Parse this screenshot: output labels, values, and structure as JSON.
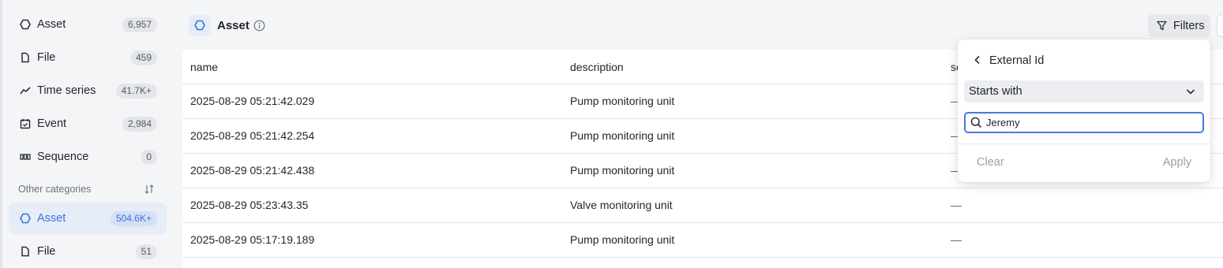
{
  "sidebar": {
    "items": [
      {
        "label": "Asset",
        "count": "6,957",
        "icon": "hexagon-icon"
      },
      {
        "label": "File",
        "count": "459",
        "icon": "file-icon"
      },
      {
        "label": "Time series",
        "count": "41.7K+",
        "icon": "timeseries-icon"
      },
      {
        "label": "Event",
        "count": "2,984",
        "icon": "calendar-icon"
      },
      {
        "label": "Sequence",
        "count": "0",
        "icon": "sequence-icon"
      }
    ],
    "section_label": "Other categories",
    "other_items": [
      {
        "label": "Asset",
        "count": "504.6K+",
        "icon": "hexagon-icon",
        "active": true
      },
      {
        "label": "File",
        "count": "51",
        "icon": "file-icon"
      }
    ]
  },
  "header": {
    "title": "Asset",
    "filters_label": "Filters"
  },
  "table": {
    "columns": [
      "name",
      "description",
      "so"
    ],
    "rows": [
      {
        "name": "2025-08-29 05:21:42.029",
        "description": "Pump monitoring unit",
        "source": "—"
      },
      {
        "name": "2025-08-29 05:21:42.254",
        "description": "Pump monitoring unit",
        "source": "—"
      },
      {
        "name": "2025-08-29 05:21:42.438",
        "description": "Pump monitoring unit",
        "source": "—"
      },
      {
        "name": "2025-08-29 05:23:43.35",
        "description": "Valve monitoring unit",
        "source": "—"
      },
      {
        "name": "2025-08-29 05:17:19.189",
        "description": "Pump monitoring unit",
        "source": "—"
      }
    ]
  },
  "filter_popover": {
    "title": "External Id",
    "operator": "Starts with",
    "search_value": "Jeremy",
    "clear_label": "Clear",
    "apply_label": "Apply"
  },
  "colors": {
    "accent": "#3a72e0",
    "active_bg": "#e6ecf8"
  }
}
